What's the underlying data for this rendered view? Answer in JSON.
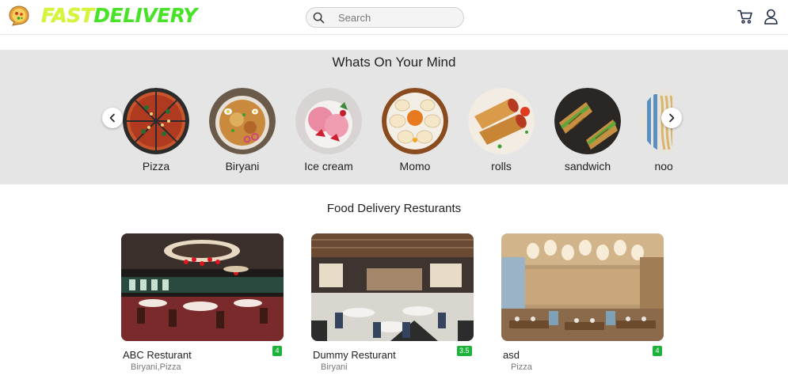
{
  "header": {
    "logo_text_fast": "FAST",
    "logo_text_delivery": "DELIVERY",
    "logo_icon": "pizza-chat-bubble-icon",
    "search_placeholder": "Search",
    "search_icon": "search-icon",
    "cart_icon": "cart-icon",
    "user_icon": "user-icon"
  },
  "woym": {
    "title": "Whats On Your Mind",
    "prev_icon": "chevron-left-icon",
    "next_icon": "chevron-right-icon",
    "categories": [
      {
        "label": "Pizza"
      },
      {
        "label": "Biryani"
      },
      {
        "label": "Ice cream"
      },
      {
        "label": "Momo"
      },
      {
        "label": "rolls"
      },
      {
        "label": "sandwich"
      },
      {
        "label": "noodles"
      }
    ]
  },
  "restaurants": {
    "title": "Food Delivery Resturants",
    "items": [
      {
        "name": "ABC Resturant",
        "cuisine": "Biryani,Pizza",
        "rating": "4"
      },
      {
        "name": "Dummy Resturant",
        "cuisine": "Biryani",
        "rating": "3.5"
      },
      {
        "name": "asd",
        "cuisine": "Pizza",
        "rating": "4"
      }
    ]
  },
  "colors": {
    "logo_fast": "#d7f43b",
    "logo_delivery": "#48e226",
    "band_bg": "#e5e5e5",
    "rating_bg": "#1db33a"
  }
}
